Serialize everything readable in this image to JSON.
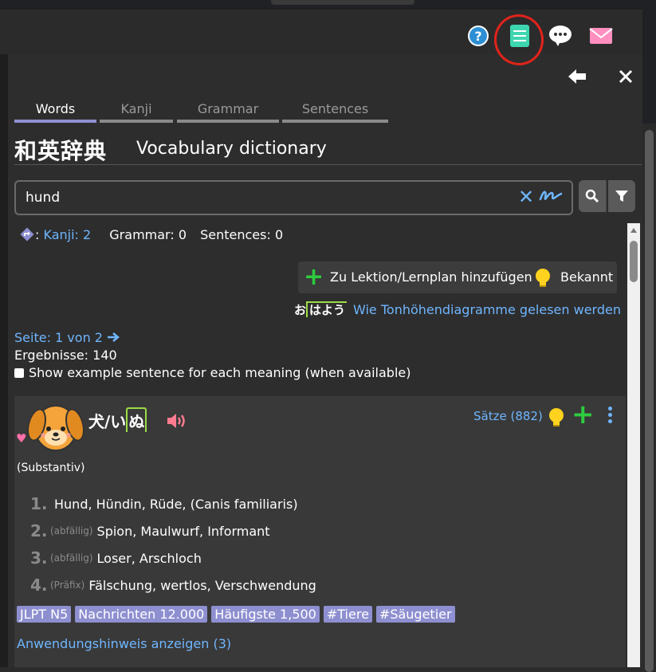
{
  "tabs": [
    {
      "label": "Words"
    },
    {
      "label": "Kanji"
    },
    {
      "label": "Grammar"
    },
    {
      "label": "Sentences"
    }
  ],
  "header": {
    "title_jp": "和英辞典",
    "title_en": "Vocabulary dictionary"
  },
  "search": {
    "value": "hund"
  },
  "counts": {
    "kanji": "Kanji: 2",
    "grammar": "Grammar: 0",
    "sentences": "Sentences: 0"
  },
  "actions": {
    "add_label": "Zu Lektion/Lernplan hinzufügen",
    "known_label": "Bekannt"
  },
  "pitch": {
    "example_o": "お",
    "example_hayou": "はよう",
    "link": "Wie Tonhöhendiagramme gelesen werden"
  },
  "pager": {
    "page_text": "Seite: 1 von 2",
    "results_text": "Ergebnisse: 140",
    "example_toggle": "Show example sentence for each meaning (when available)"
  },
  "entry": {
    "word_base": "犬/い",
    "word_high": "ぬ",
    "sentences_link": "Sätze (882)",
    "part_of_speech": "(Substantiv)",
    "meanings": [
      {
        "num": "1.",
        "tag": "",
        "text": "Hund, Hündin, Rüde, (Canis familiaris)"
      },
      {
        "num": "2.",
        "tag": "(abfällig)",
        "text": "Spion, Maulwurf, Informant"
      },
      {
        "num": "3.",
        "tag": "(abfällig)",
        "text": "Loser, Arschloch"
      },
      {
        "num": "4.",
        "tag": "(Präfix)",
        "text": "Fälschung, wertlos, Verschwendung"
      }
    ],
    "tags": [
      "JLPT N5",
      "Nachrichten 12.000",
      "Häufigste 1,500",
      "#Tiere",
      "#Säugetier"
    ],
    "usage_link": "Anwendungshinweis anzeigen (3)"
  },
  "colors": {
    "accent": "#8e8fd0",
    "link": "#6fb6ff",
    "green": "#2ecc40",
    "pitch": "#9bdc45",
    "highlight": "#e2231a"
  }
}
